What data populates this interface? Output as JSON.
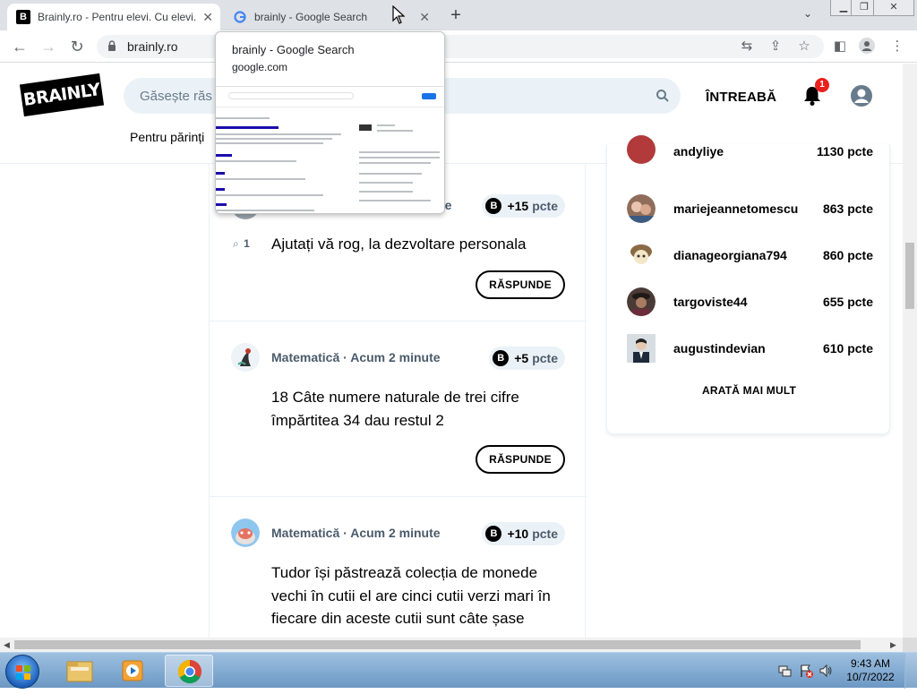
{
  "browser": {
    "tabs": [
      {
        "title": "Brainly.ro - Pentru elevi. Cu elevi.",
        "favicon": "brainly-favicon",
        "active": true
      },
      {
        "title": "brainly - Google Search",
        "favicon": "google-favicon",
        "active": false
      }
    ],
    "url": "brainly.ro"
  },
  "tab_preview": {
    "title": "brainly - Google Search",
    "url": "google.com"
  },
  "header": {
    "logo": "BRAINLY",
    "search_placeholder": "Găsește răs",
    "ask_label": "ÎNTREABĂ",
    "notification_count": "1",
    "subnav_label": "Pentru părinți"
  },
  "questions": [
    {
      "subject": "",
      "time": "",
      "points": "+15",
      "points_unit": "pcte",
      "attachments": "1",
      "text": "Ajutați vă rog, la dezvoltare personala",
      "answer_label": "RĂSPUNDE",
      "meta_tail": "te"
    },
    {
      "subject": "Matematică",
      "time": "Acum 2 minute",
      "points": "+5",
      "points_unit": "pcte",
      "text": "18 Câte numere naturale de trei cifre împărtitea 34 dau restul 2",
      "answer_label": "RĂSPUNDE"
    },
    {
      "subject": "Matematică",
      "time": "Acum 2 minute",
      "points": "+10",
      "points_unit": "pcte",
      "text": "Tudor își păstrează colecția de monede vechi în cutii el are cinci cutii verzi mari în fiecare din aceste cutii sunt câte șase"
    }
  ],
  "ranking": {
    "rows": [
      {
        "name": "andyliye",
        "points": "1130 pcte"
      },
      {
        "name": "mariejeannetomescu",
        "points": "863 pcte"
      },
      {
        "name": "dianageorgiana794",
        "points": "860 pcte"
      },
      {
        "name": "targoviste44",
        "points": "655 pcte"
      },
      {
        "name": "augustindevian",
        "points": "610 pcte"
      }
    ],
    "show_more": "ARATĂ MAI MULT"
  },
  "taskbar": {
    "time": "9:43 AM",
    "date": "10/7/2022"
  },
  "colors": {
    "brainly_black": "#000000",
    "badge_red": "#e9201d",
    "search_bg": "#ebf2f7"
  }
}
